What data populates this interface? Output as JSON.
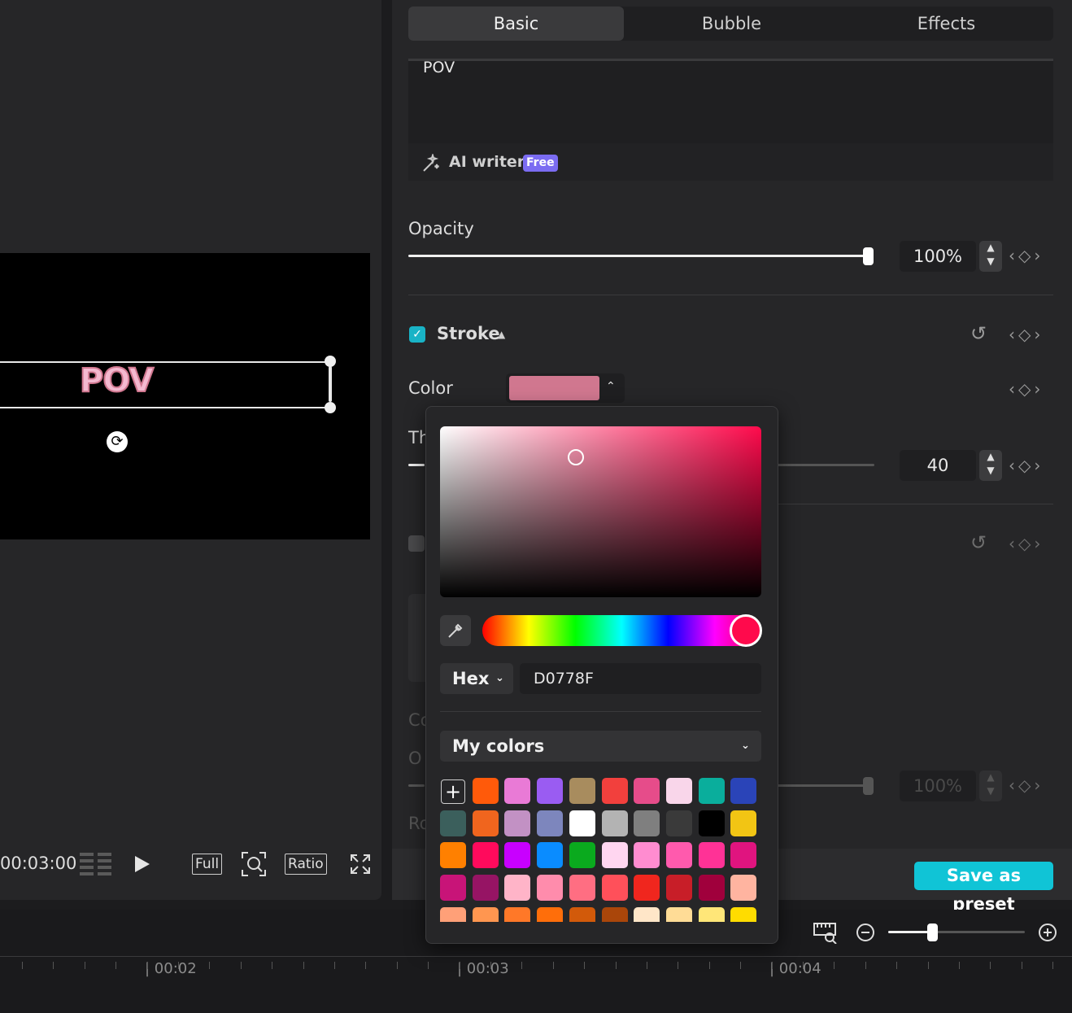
{
  "preview": {
    "overlay_text": "POV",
    "timecode": "00:03:00",
    "controls": {
      "full": "Full",
      "ratio": "Ratio"
    }
  },
  "inspector": {
    "tabs": [
      {
        "label": "Basic",
        "active": true
      },
      {
        "label": "Bubble",
        "active": false
      },
      {
        "label": "Effects",
        "active": false
      }
    ],
    "text_value": "POV",
    "ai_writer": {
      "label": "AI writer",
      "badge": "Free"
    },
    "opacity": {
      "label": "Opacity",
      "value": "100%",
      "level": 1.0
    },
    "stroke": {
      "label": "Stroke",
      "enabled": true
    },
    "color": {
      "label": "Color",
      "value": "#D0778F"
    },
    "thickness": {
      "label_partial": "Th",
      "value": "40"
    },
    "faded_labels": {
      "c": "Co",
      "o": "O",
      "r": "Ro"
    },
    "faded_opacity_value": "100%",
    "save_preset": "Save as preset"
  },
  "picker": {
    "mode": "Hex",
    "hex_value": "D0778F",
    "hue_color": "#ff0a4c",
    "palette_label": "My colors",
    "swatches": [
      [
        "#ff5a0a",
        "#e97ad6",
        "#9a5cf2",
        "#a88c5e",
        "#f2403d",
        "#e64c8a",
        "#f9d6ea",
        "#0aae9c",
        "#2a44b8"
      ],
      [
        "#3b5f5c",
        "#f0651e",
        "#c291c4",
        "#7d86bd",
        "#ffffff",
        "#b3b3b3",
        "#7f7f7f",
        "#3a3a3a",
        "#000000",
        "#f2c514"
      ],
      [
        "#ff8000",
        "#ff0a5c",
        "#c800ff",
        "#0a8cff",
        "#0aaa1e",
        "#ffd6f0",
        "#ff8cd0",
        "#ff5aad",
        "#ff3296",
        "#e0147f"
      ],
      [
        "#c81478",
        "#961464",
        "#ffb4c8",
        "#ff8cac",
        "#ff6e82",
        "#ff505a",
        "#f0261e",
        "#c81e28",
        "#a0003c",
        "#ffb4a0"
      ],
      [
        "#ffa078",
        "#ff9650",
        "#ff7828",
        "#ff6e0a",
        "#d25a0a",
        "#aa460a",
        "#ffe6c8",
        "#ffdc96",
        "#ffe678",
        "#ffdc00"
      ]
    ]
  },
  "timeline": {
    "labels": [
      "00:02",
      "00:03",
      "00:04"
    ]
  }
}
